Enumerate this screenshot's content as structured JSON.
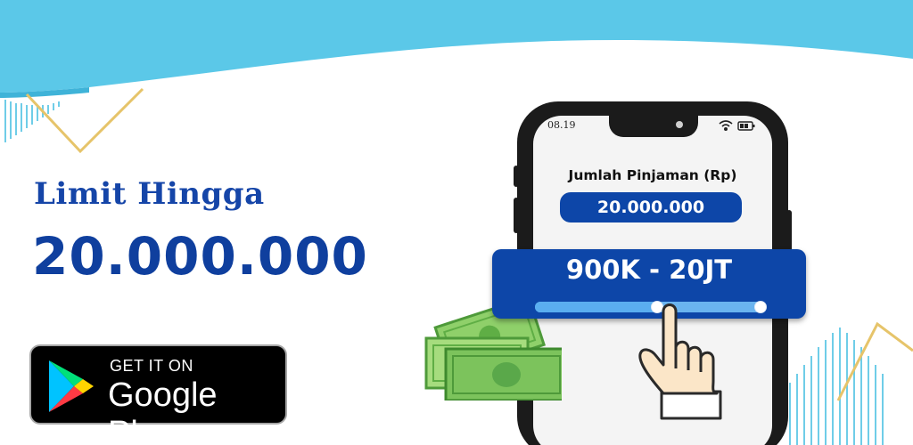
{
  "promo": {
    "headline": "Limit Hingga",
    "amount": "20.000.000"
  },
  "store_badge": {
    "top_text": "GET IT ON",
    "store_name": "Google Play",
    "icon": "google-play-icon"
  },
  "phone": {
    "time": "08.19",
    "status_icons": [
      "wifi-icon",
      "battery-icon"
    ],
    "loan_label": "Jumlah Pinjaman (Rp)",
    "loan_value": "20.000.000",
    "range_label": "900K - 20JT",
    "slider_level": 0.53
  },
  "colors": {
    "primary_blue": "#0d46a8",
    "sky_blue": "#5bc8e8",
    "accent_gold": "#e6c46a",
    "money_green": "#7cc35c"
  }
}
